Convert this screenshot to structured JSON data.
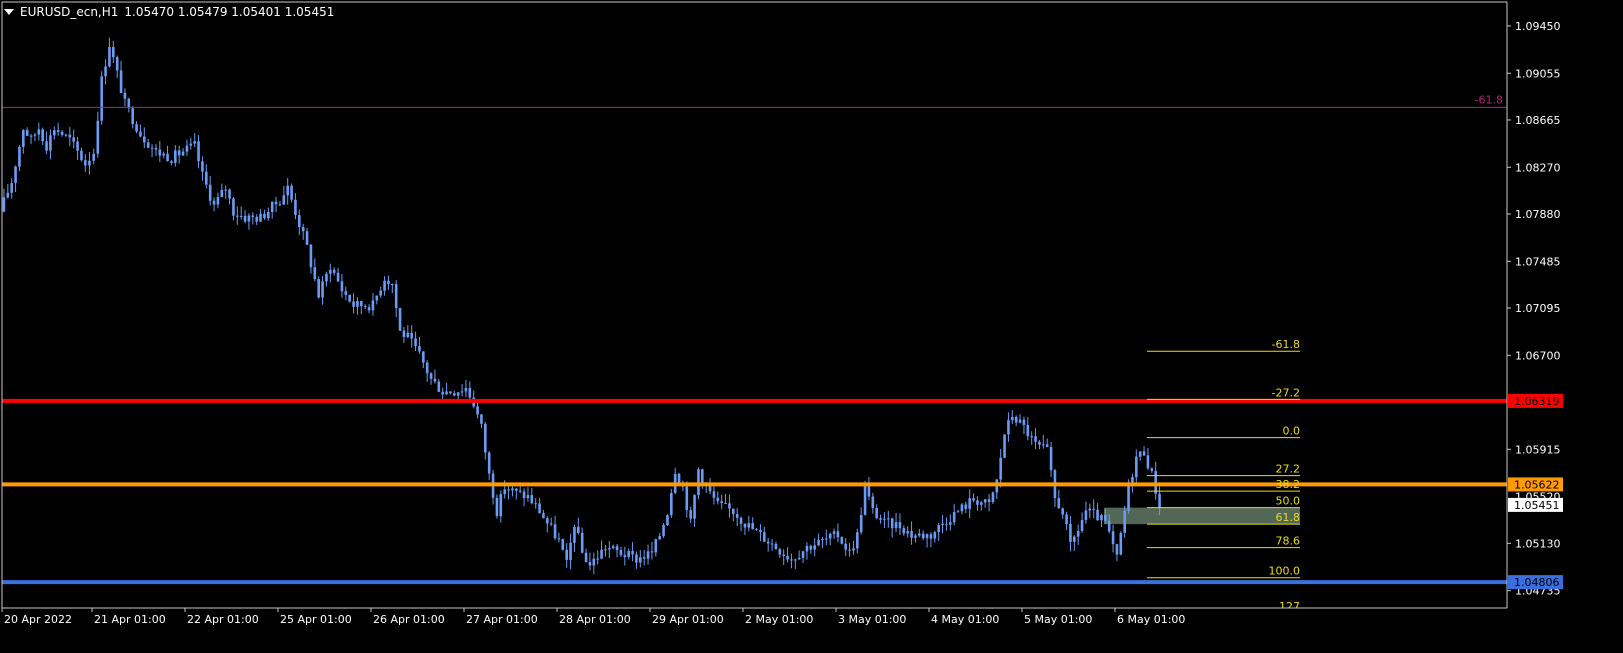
{
  "symbol_header": {
    "symbol": "EURUSD_ecn,H1",
    "ohlc": "1.05470 1.05479 1.05401 1.05451"
  },
  "colors": {
    "background": "#000000",
    "grid_axis": "#c8c8c8",
    "candle": "#6a9cf5",
    "red_line": "#ff0000",
    "orange_line": "#ff9a00",
    "blue_line": "#3a6fe0",
    "magenta_line": "#b0247a",
    "fib": "#e8dc1c",
    "zone_fill": "#6d8a73",
    "text": "#ffffff"
  },
  "chart_data": {
    "type": "candlestick",
    "y_range": [
      1.0459,
      1.0965
    ],
    "price_axis_labels": [
      "1.09450",
      "1.09055",
      "1.08665",
      "1.08270",
      "1.07880",
      "1.07485",
      "1.07095",
      "1.06700",
      "1.05915",
      "1.05130",
      "1.04735"
    ],
    "time_axis_labels": [
      "20 Apr 2022",
      "21 Apr 01:00",
      "22 Apr 01:00",
      "25 Apr 01:00",
      "26 Apr 01:00",
      "27 Apr 01:00",
      "28 Apr 01:00",
      "29 Apr 01:00",
      "2 May 01:00",
      "3 May 01:00",
      "4 May 01:00",
      "5 May 01:00",
      "6 May 01:00"
    ],
    "horizontal_lines": [
      {
        "name": "red",
        "price": 1.06319,
        "label": "1.06319",
        "color": "#ff0000"
      },
      {
        "name": "orange",
        "price": 1.05622,
        "label": "1.05622",
        "color": "#ff9a00"
      },
      {
        "name": "blue",
        "price": 1.04806,
        "label": "1.04806",
        "color": "#3a6fe0"
      },
      {
        "name": "magenta",
        "price": 1.0877,
        "label": "-61.8",
        "color": "#b0247a"
      }
    ],
    "current_price": {
      "price": 1.05451,
      "label": "1.05451"
    },
    "partial_price_label": "1.05520",
    "fibonacci": {
      "levels": [
        {
          "label": "-61.8",
          "price": 1.06734
        },
        {
          "label": "-27.2",
          "price": 1.06332
        },
        {
          "label": "0.0",
          "price": 1.06013
        },
        {
          "label": "27.2",
          "price": 1.05695
        },
        {
          "label": "38.2",
          "price": 1.05566
        },
        {
          "label": "50.0",
          "price": 1.05428
        },
        {
          "label": "61.8",
          "price": 1.0529
        },
        {
          "label": "78.6",
          "price": 1.05094
        },
        {
          "label": "100.0",
          "price": 1.04843
        },
        {
          "label": "127",
          "price": 1.0451
        }
      ],
      "zone_price_range": [
        1.0529,
        1.05428
      ]
    },
    "series": [
      {
        "name": "EURUSD_ecn,H1",
        "anchors": [
          [
            "20 Apr 00:00",
            1.079
          ],
          [
            "20 Apr 03:00",
            1.0815
          ],
          [
            "20 Apr 06:00",
            1.086
          ],
          [
            "20 Apr 08:00",
            1.085
          ],
          [
            "20 Apr 10:00",
            1.086
          ],
          [
            "20 Apr 12:00",
            1.0845
          ],
          [
            "20 Apr 14:00",
            1.086
          ],
          [
            "20 Apr 16:00",
            1.0855
          ],
          [
            "20 Apr 18:00",
            1.085
          ],
          [
            "20 Apr 22:00",
            1.083
          ],
          [
            "21 Apr 01:00",
            1.084
          ],
          [
            "21 Apr 03:00",
            1.09
          ],
          [
            "21 Apr 05:00",
            1.093
          ],
          [
            "21 Apr 07:00",
            1.0905
          ],
          [
            "21 Apr 09:00",
            1.088
          ],
          [
            "21 Apr 13:00",
            1.0855
          ],
          [
            "21 Apr 17:00",
            1.084
          ],
          [
            "21 Apr 21:00",
            1.0835
          ],
          [
            "22 Apr 01:00",
            1.0842
          ],
          [
            "22 Apr 03:00",
            1.0845
          ],
          [
            "22 Apr 05:00",
            1.082
          ],
          [
            "22 Apr 08:00",
            1.0795
          ],
          [
            "22 Apr 11:00",
            1.081
          ],
          [
            "22 Apr 13:00",
            1.079
          ],
          [
            "22 Apr 16:00",
            1.0785
          ],
          [
            "22 Apr 20:00",
            1.0785
          ],
          [
            "25 Apr 01:00",
            1.08
          ],
          [
            "25 Apr 03:00",
            1.081
          ],
          [
            "25 Apr 06:00",
            1.078
          ],
          [
            "25 Apr 08:00",
            1.076
          ],
          [
            "25 Apr 11:00",
            1.072
          ],
          [
            "25 Apr 14:00",
            1.0745
          ],
          [
            "25 Apr 17:00",
            1.0725
          ],
          [
            "25 Apr 20:00",
            1.0712
          ],
          [
            "26 Apr 01:00",
            1.0712
          ],
          [
            "26 Apr 02:00",
            1.072
          ],
          [
            "26 Apr 04:00",
            1.0735
          ],
          [
            "26 Apr 06:00",
            1.073
          ],
          [
            "26 Apr 08:00",
            1.069
          ],
          [
            "26 Apr 10:00",
            1.0685
          ],
          [
            "26 Apr 13:00",
            1.067
          ],
          [
            "26 Apr 16:00",
            1.065
          ],
          [
            "26 Apr 19:00",
            1.064
          ],
          [
            "26 Apr 22:00",
            1.064
          ],
          [
            "27 Apr 01:00",
            1.0643
          ],
          [
            "27 Apr 03:00",
            1.063
          ],
          [
            "27 Apr 05:00",
            1.061
          ],
          [
            "27 Apr 07:00",
            1.057
          ],
          [
            "27 Apr 09:00",
            1.054
          ],
          [
            "27 Apr 11:00",
            1.056
          ],
          [
            "27 Apr 14:00",
            1.0555
          ],
          [
            "27 Apr 17:00",
            1.0552
          ],
          [
            "27 Apr 20:00",
            1.054
          ],
          [
            "28 Apr 01:00",
            1.0515
          ],
          [
            "28 Apr 03:00",
            1.0495
          ],
          [
            "28 Apr 05:00",
            1.053
          ],
          [
            "28 Apr 07:00",
            1.0505
          ],
          [
            "28 Apr 09:00",
            1.0495
          ],
          [
            "28 Apr 13:00",
            1.051
          ],
          [
            "28 Apr 17:00",
            1.0505
          ],
          [
            "28 Apr 21:00",
            1.05
          ],
          [
            "29 Apr 01:00",
            1.0505
          ],
          [
            "29 Apr 03:00",
            1.052
          ],
          [
            "29 Apr 05:00",
            1.054
          ],
          [
            "29 Apr 07:00",
            1.0575
          ],
          [
            "29 Apr 09:00",
            1.056
          ],
          [
            "29 Apr 11:00",
            1.053
          ],
          [
            "29 Apr 13:00",
            1.0575
          ],
          [
            "29 Apr 15:00",
            1.056
          ],
          [
            "29 Apr 18:00",
            1.0545
          ],
          [
            "29 Apr 22:00",
            1.054
          ],
          [
            "2 May 01:00",
            1.053
          ],
          [
            "2 May 05:00",
            1.052
          ],
          [
            "2 May 09:00",
            1.051
          ],
          [
            "2 May 13:00",
            1.05
          ],
          [
            "2 May 17:00",
            1.051
          ],
          [
            "2 May 21:00",
            1.0515
          ],
          [
            "3 May 01:00",
            1.052
          ],
          [
            "3 May 04:00",
            1.0505
          ],
          [
            "3 May 06:00",
            1.052
          ],
          [
            "3 May 08:00",
            1.056
          ],
          [
            "3 May 10:00",
            1.054
          ],
          [
            "3 May 13:00",
            1.053
          ],
          [
            "3 May 17:00",
            1.0528
          ],
          [
            "3 May 20:00",
            1.052
          ],
          [
            "4 May 01:00",
            1.052
          ],
          [
            "4 May 04:00",
            1.053
          ],
          [
            "4 May 08:00",
            1.054
          ],
          [
            "4 May 12:00",
            1.055
          ],
          [
            "4 May 16:00",
            1.0545
          ],
          [
            "4 May 18:00",
            1.0565
          ],
          [
            "4 May 20:00",
            1.0605
          ],
          [
            "4 May 22:00",
            1.062
          ],
          [
            "5 May 01:00",
            1.061
          ],
          [
            "5 May 04:00",
            1.0595
          ],
          [
            "5 May 07:00",
            1.059
          ],
          [
            "5 May 09:00",
            1.055
          ],
          [
            "5 May 11:00",
            1.054
          ],
          [
            "5 May 13:00",
            1.051
          ],
          [
            "5 May 15:00",
            1.0525
          ],
          [
            "5 May 17:00",
            1.054
          ],
          [
            "5 May 20:00",
            1.0535
          ],
          [
            "5 May 22:00",
            1.053
          ],
          [
            "6 May 01:00",
            1.05
          ],
          [
            "6 May 02:00",
            1.052
          ],
          [
            "6 May 04:00",
            1.056
          ],
          [
            "6 May 06:00",
            1.0585
          ],
          [
            "6 May 08:00",
            1.059
          ],
          [
            "6 May 10:00",
            1.057
          ],
          [
            "6 May 12:00",
            1.05451
          ]
        ]
      }
    ]
  }
}
